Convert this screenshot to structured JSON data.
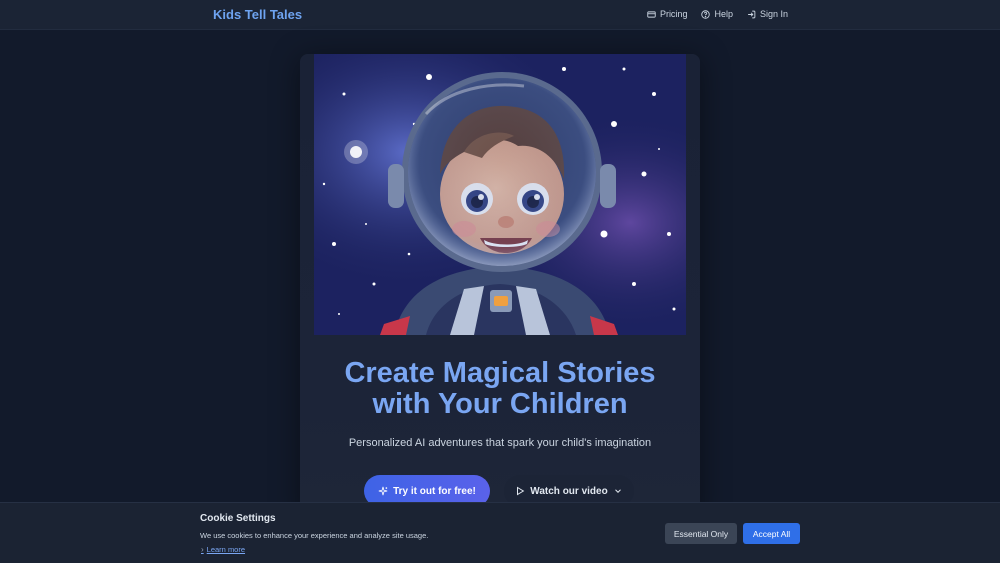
{
  "header": {
    "brand": "Kids Tell Tales",
    "nav": [
      {
        "label": "Pricing",
        "icon": "card-icon"
      },
      {
        "label": "Help",
        "icon": "help-circle-icon"
      },
      {
        "label": "Sign In",
        "icon": "sign-in-icon"
      }
    ]
  },
  "hero": {
    "image": "astronaut-child-illustration",
    "headline_line1": "Create Magical Stories",
    "headline_line2": "with Your Children",
    "subline": "Personalized AI adventures that spark your child's imagination",
    "primary_button": "Try it out for free!",
    "secondary_button": "Watch our video"
  },
  "cookie": {
    "title": "Cookie Settings",
    "text": "We use cookies to enhance your experience and analyze site usage.",
    "learn_more": "Learn more",
    "essential_button": "Essential Only",
    "accept_button": "Accept All"
  },
  "colors": {
    "accent": "#6ea3f0",
    "primary_button": "#3e63e6",
    "accept_button": "#2f6fe8",
    "background": "#121a2b"
  }
}
